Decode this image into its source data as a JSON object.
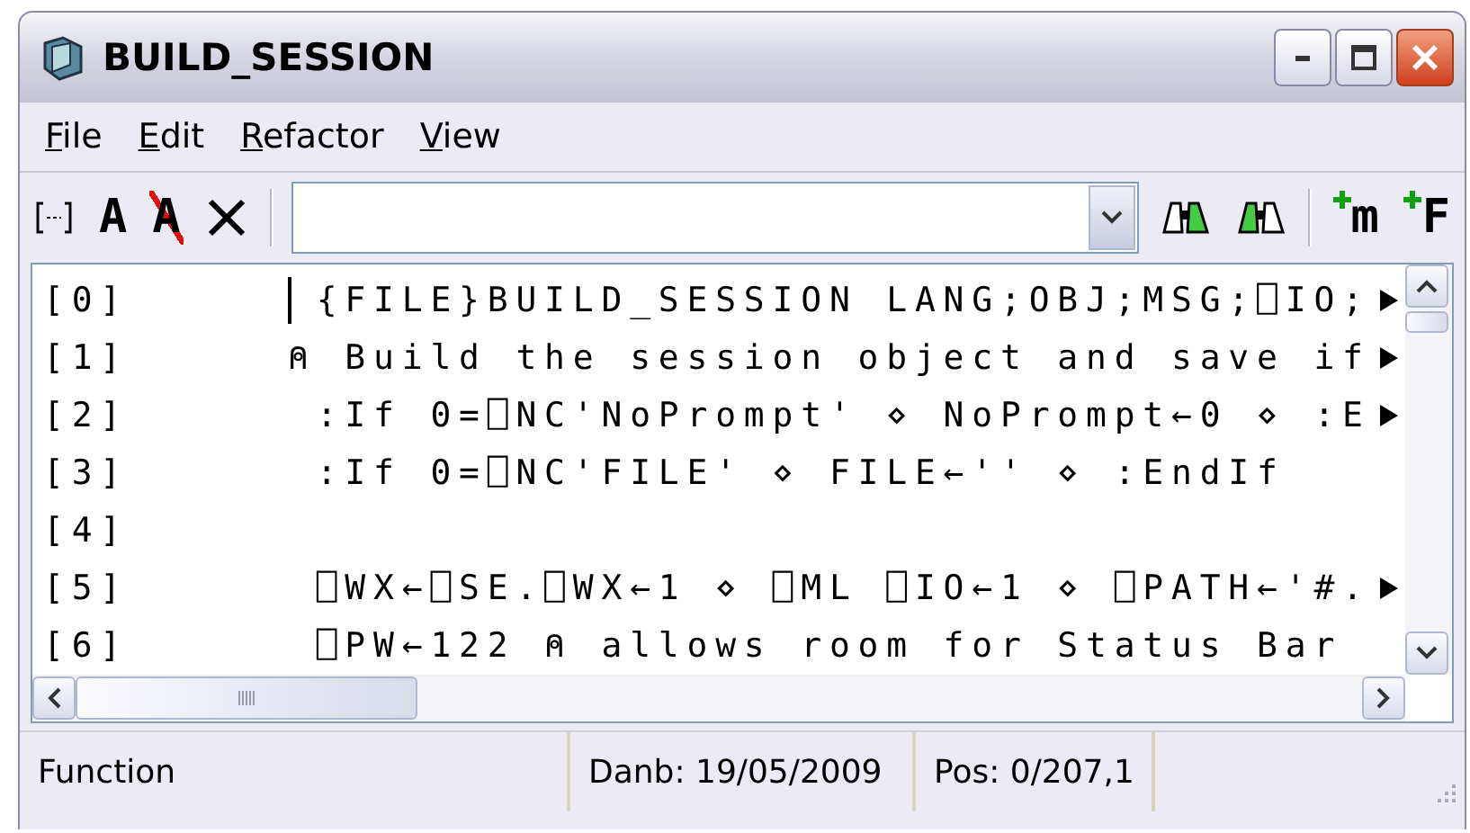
{
  "window": {
    "title": "BUILD_SESSION"
  },
  "menu": [
    {
      "label": "File"
    },
    {
      "label": "Edit"
    },
    {
      "label": "Refactor"
    },
    {
      "label": "View"
    }
  ],
  "toolbar": [
    {
      "kind": "brackets"
    },
    {
      "kind": "letter",
      "label": "A"
    },
    {
      "kind": "struck",
      "label": "A"
    },
    {
      "kind": "delete"
    },
    {
      "kind": "separator"
    },
    {
      "kind": "combo"
    },
    {
      "kind": "find-next"
    },
    {
      "kind": "find"
    },
    {
      "kind": "separator"
    },
    {
      "kind": "add",
      "label": "m"
    },
    {
      "kind": "add",
      "label": "F"
    }
  ],
  "editor": {
    "lines": [
      {
        "number": "[0]",
        "code": " {FILE}BUILD_SESSION LANG;OBJ;MSG;⎕IO;",
        "continues": true,
        "cursor": true
      },
      {
        "number": "[1]",
        "code": "⍝ Build the session object and save if",
        "continues": true,
        "cursor": false
      },
      {
        "number": "[2]",
        "code": " :If 0=⎕NC'NoPrompt' ⋄ NoPrompt←0 ⋄ :E",
        "continues": true,
        "cursor": false
      },
      {
        "number": "[3]",
        "code": " :If 0=⎕NC'FILE' ⋄ FILE←'' ⋄ :EndIf",
        "continues": false,
        "cursor": false
      },
      {
        "number": "[4]",
        "continues": false,
        "cursor": false
      },
      {
        "number": "[5]",
        "code": " ⎕WX←⎕SE.⎕WX←1 ⋄ ⎕ML ⎕IO←1 ⋄ ⎕PATH←'#.",
        "continues": true,
        "cursor": false
      },
      {
        "number": "[6]",
        "code": " ⎕PW←122 ⍝ allows room for Status Bar",
        "continues": false,
        "cursor": false
      }
    ]
  },
  "status_bar": [
    "Function",
    "Danb: 19/05/2009",
    "Pos: 0/207,1"
  ]
}
